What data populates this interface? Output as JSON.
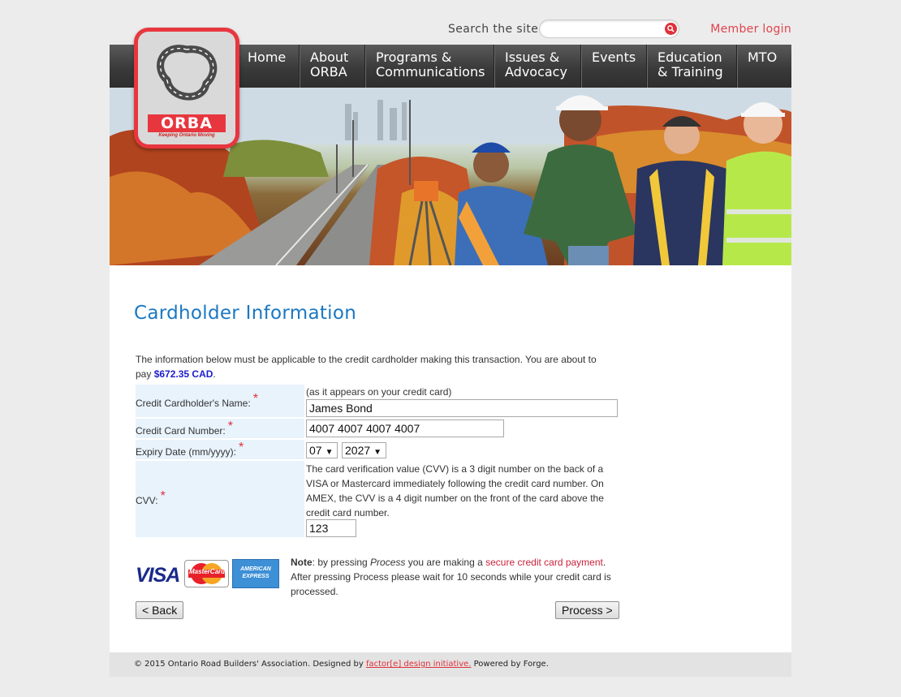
{
  "header": {
    "search_label": "Search the site:",
    "search_placeholder": "",
    "member_login": "Member login"
  },
  "logo": {
    "word": "ORBA",
    "tagline": "Keeping Ontario Moving"
  },
  "nav": {
    "items": [
      {
        "line1": "Home",
        "line2": ""
      },
      {
        "line1": "About",
        "line2": "ORBA"
      },
      {
        "line1": "Programs &",
        "line2": "Communications"
      },
      {
        "line1": "Issues &",
        "line2": "Advocacy"
      },
      {
        "line1": "Events",
        "line2": ""
      },
      {
        "line1": "Education",
        "line2": "& Training"
      },
      {
        "line1": "MTO",
        "line2": ""
      }
    ]
  },
  "page": {
    "title": "Cardholder Information",
    "intro_text": "The information below must be applicable to the credit cardholder making this transaction. You are about to pay",
    "amount": "$672.35 CAD",
    "intro_end": "."
  },
  "form": {
    "name_label": "Credit Cardholder's Name:",
    "name_hint": "(as it appears on your credit card)",
    "name_value": "James Bond",
    "card_label": "Credit Card Number:",
    "card_value": "4007 4007 4007 4007",
    "expiry_label": "Expiry Date (mm/yyyy):",
    "expiry_month": "07",
    "expiry_year": "2027",
    "cvv_label": "CVV:",
    "cvv_help": "The card verification value (CVV) is a 3 digit number on the back of a VISA or Mastercard immediately following the credit card number. On AMEX, the CVV is a 4 digit number on the front of the card above the credit card number.",
    "cvv_value": "123",
    "required_mark": "*"
  },
  "cards": {
    "visa": "VISA",
    "mastercard": "MasterCard",
    "amex_line1": "AMERICAN",
    "amex_line2": "EXPRESS"
  },
  "note": {
    "bold": "Note",
    "part1": ": by pressing ",
    "process_word": "Process",
    "part2": " you are making a ",
    "link": "secure credit card payment",
    "part3": ".",
    "line2": "After pressing Process please wait for 10 seconds while your credit card is processed."
  },
  "buttons": {
    "back": "< Back",
    "process": "Process >"
  },
  "footer": {
    "copyright": "© 2015 Ontario Road Builders' Association. Designed by ",
    "designer": "factor[e] design initiative.",
    "powered": " Powered by Forge."
  },
  "colors": {
    "accent_red": "#e0303a",
    "title_blue": "#1b78c2",
    "label_bg": "#e8f3fc",
    "amount_blue": "#1c1ccf"
  }
}
